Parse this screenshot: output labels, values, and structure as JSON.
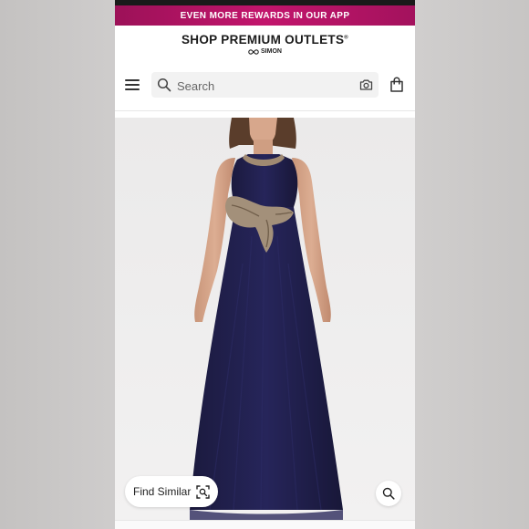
{
  "promo_banner": {
    "text": "EVEN MORE REWARDS IN OUR APP"
  },
  "brand": {
    "title": "SHOP PREMIUM OUTLETS",
    "trademark": "®",
    "subtitle": "SIMON"
  },
  "search": {
    "placeholder": "Search"
  },
  "actions": {
    "find_similar_label": "Find Similar"
  },
  "icons": {
    "menu": "hamburger-menu-icon",
    "search": "search-icon",
    "camera": "camera-icon",
    "bag": "shopping-bag-icon",
    "scan": "image-scan-icon",
    "zoom": "zoom-icon"
  },
  "colors": {
    "promo_background": "#b31466",
    "dress": "#1e1d45",
    "lace_appliqué": "#a08a72",
    "text": "#1b1b1b"
  }
}
